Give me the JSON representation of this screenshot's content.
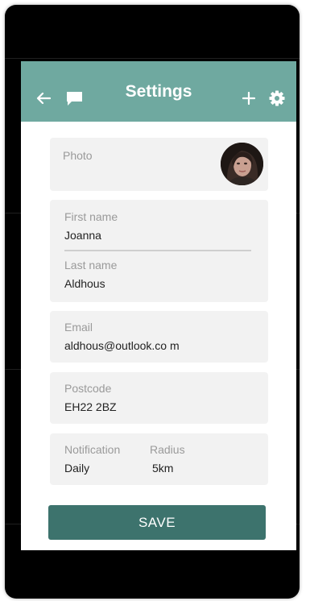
{
  "app_bar": {
    "title": "Settings",
    "left_icons": [
      "arrow-left-icon",
      "chat-icon"
    ],
    "right_icons": [
      "plus-icon",
      "gear-icon"
    ],
    "color": "#6fa9a0"
  },
  "form": {
    "photo": {
      "label": "Photo"
    },
    "first_name": {
      "label": "First name",
      "value": "Joanna"
    },
    "last_name": {
      "label": "Last name",
      "value": "Aldhous"
    },
    "email": {
      "label": "Email",
      "value": "aldhous@outlook.co m"
    },
    "postcode": {
      "label": "Postcode",
      "value": "EH22 2BZ"
    },
    "notification": {
      "label": "Notification",
      "value": "Daily"
    },
    "radius": {
      "label": "Radius",
      "value": "5km"
    }
  },
  "save_button": {
    "label": "SAVE",
    "color": "#3d736d"
  }
}
